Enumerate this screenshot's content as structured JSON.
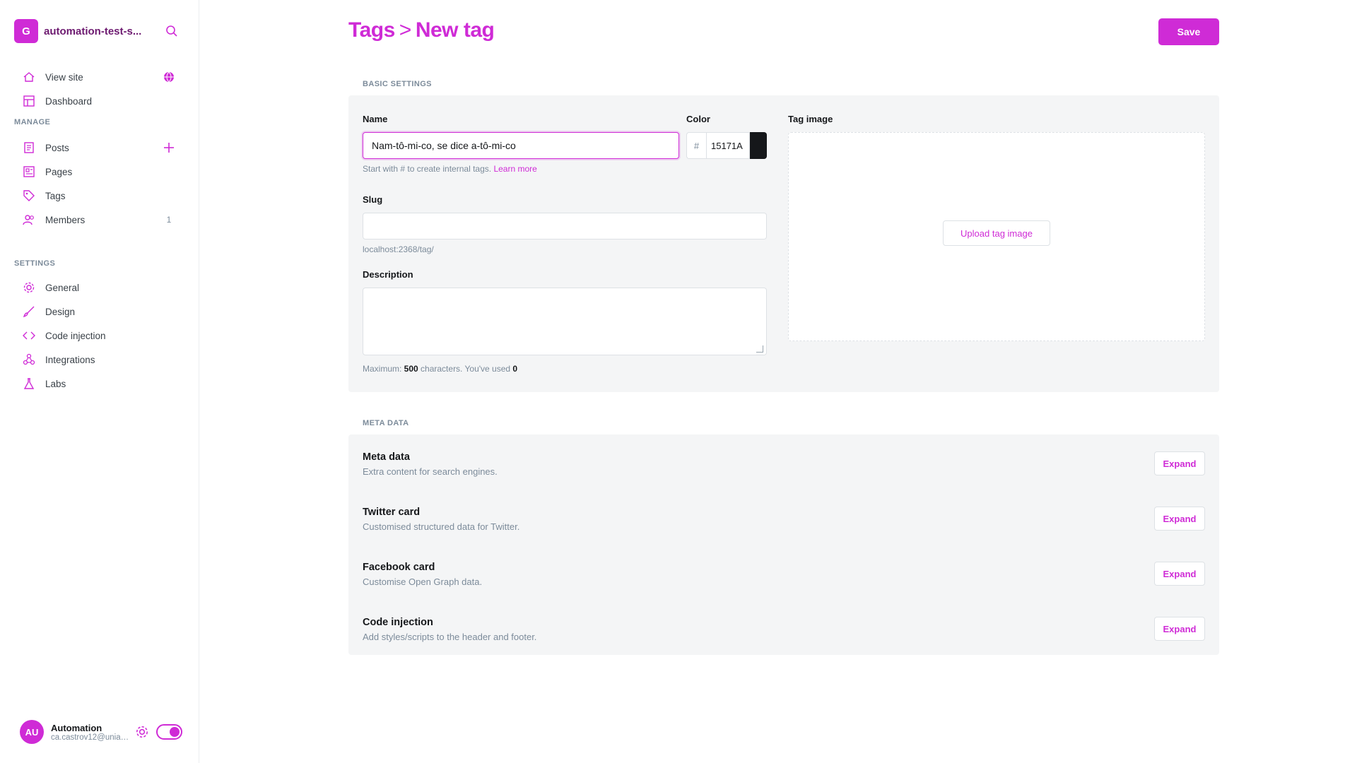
{
  "sidebar": {
    "site_title": "automation-test-s...",
    "logo_text": "G",
    "top_items": [
      {
        "label": "View site",
        "icon": "home-icon"
      },
      {
        "label": "Dashboard",
        "icon": "dashboard-icon"
      }
    ],
    "manage_heading": "MANAGE",
    "manage_items": [
      {
        "label": "Posts",
        "icon": "posts-icon"
      },
      {
        "label": "Pages",
        "icon": "pages-icon"
      },
      {
        "label": "Tags",
        "icon": "tag-icon"
      },
      {
        "label": "Members",
        "icon": "members-icon",
        "count": "1"
      }
    ],
    "settings_heading": "SETTINGS",
    "settings_items": [
      {
        "label": "General",
        "icon": "gear-icon"
      },
      {
        "label": "Design",
        "icon": "brush-icon"
      },
      {
        "label": "Code injection",
        "icon": "code-icon"
      },
      {
        "label": "Integrations",
        "icon": "integrations-icon"
      },
      {
        "label": "Labs",
        "icon": "flask-icon"
      }
    ],
    "user": {
      "avatar_text": "AU",
      "name": "Automation",
      "email": "ca.castrov12@uniandes.edu.co"
    }
  },
  "header": {
    "breadcrumb_parent": "Tags",
    "breadcrumb_sep": ">",
    "breadcrumb_current": "New tag",
    "save_label": "Save"
  },
  "basic": {
    "section_label": "BASIC SETTINGS",
    "name_label": "Name",
    "name_value": "Nam-tô-mi-co, se dice a-tô-mi-co",
    "name_hint_prefix": "Start with # to create internal tags.",
    "name_hint_link": "Learn more",
    "color_label": "Color",
    "color_hash": "#",
    "color_value": "15171A",
    "slug_label": "Slug",
    "slug_value": "",
    "slug_hint": "localhost:2368/tag/",
    "description_label": "Description",
    "description_value": "",
    "desc_hint_prefix": "Maximum: ",
    "desc_hint_max": "500",
    "desc_hint_mid": " characters. You've used ",
    "desc_hint_used": "0",
    "image_label": "Tag image",
    "upload_label": "Upload tag image"
  },
  "meta": {
    "section_label": "META DATA",
    "expand_label": "Expand",
    "rows": [
      {
        "title": "Meta data",
        "desc": "Extra content for search engines."
      },
      {
        "title": "Twitter card",
        "desc": "Customised structured data for Twitter."
      },
      {
        "title": "Facebook card",
        "desc": "Customise Open Graph data."
      },
      {
        "title": "Code injection",
        "desc": "Add styles/scripts to the header and footer."
      }
    ]
  },
  "colors": {
    "accent": "#cf2bd6",
    "panel_bg": "#f4f5f6",
    "muted": "#7c8b9a"
  }
}
